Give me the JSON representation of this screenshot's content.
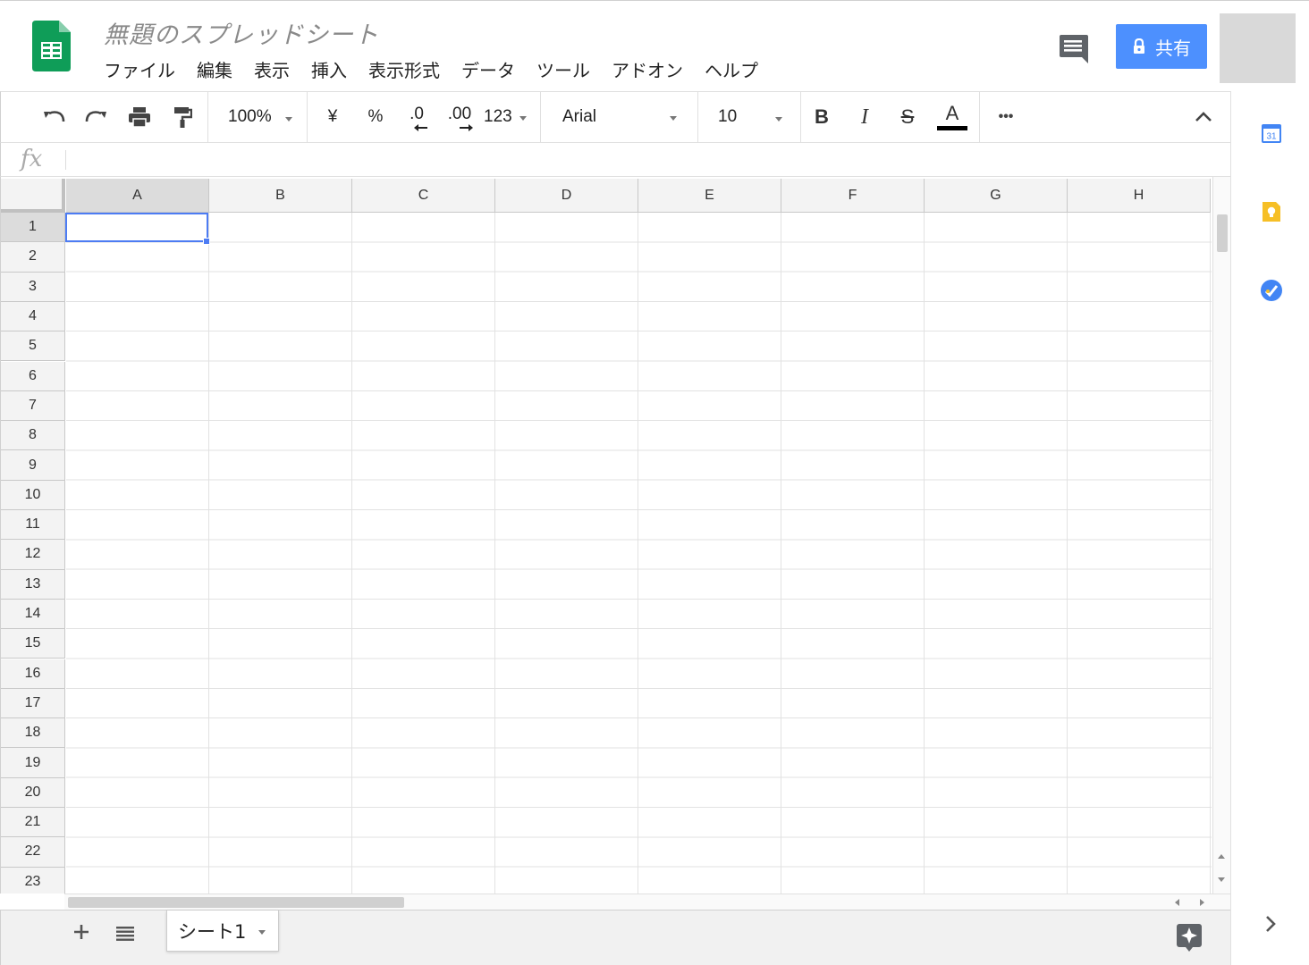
{
  "header": {
    "doc_title": "無題のスプレッドシート",
    "share_label": "共有",
    "menu": [
      "ファイル",
      "編集",
      "表示",
      "挿入",
      "表示形式",
      "データ",
      "ツール",
      "アドオン",
      "ヘルプ"
    ]
  },
  "toolbar": {
    "zoom": "100%",
    "currency": "¥",
    "percent": "%",
    "dec_decrease": ".0",
    "dec_increase": ".00",
    "number_format": "123",
    "font": "Arial",
    "font_size": "10",
    "bold": "B",
    "italic": "I",
    "strike": "S",
    "text_color": "A",
    "more": "•••"
  },
  "formula_bar": {
    "fx_label": "fx",
    "value": ""
  },
  "grid": {
    "columns": [
      "A",
      "B",
      "C",
      "D",
      "E",
      "F",
      "G",
      "H"
    ],
    "rows": [
      "1",
      "2",
      "3",
      "4",
      "5",
      "6",
      "7",
      "8",
      "9",
      "10",
      "11",
      "12",
      "13",
      "14",
      "15",
      "16",
      "17",
      "18",
      "19",
      "20",
      "21",
      "22",
      "23"
    ],
    "selected_cell": "A1"
  },
  "sheets": {
    "tabs": [
      {
        "label": "シート1"
      }
    ]
  },
  "side_panel": {
    "icons": [
      "calendar-icon",
      "keep-icon",
      "tasks-icon"
    ],
    "calendar_day": "31"
  },
  "colors": {
    "accent": "#4d90fe",
    "selection": "#4d7cf3",
    "sheets_green": "#0f9d58",
    "keep_yellow": "#f6bf26",
    "header_bg": "#f3f3f3"
  }
}
